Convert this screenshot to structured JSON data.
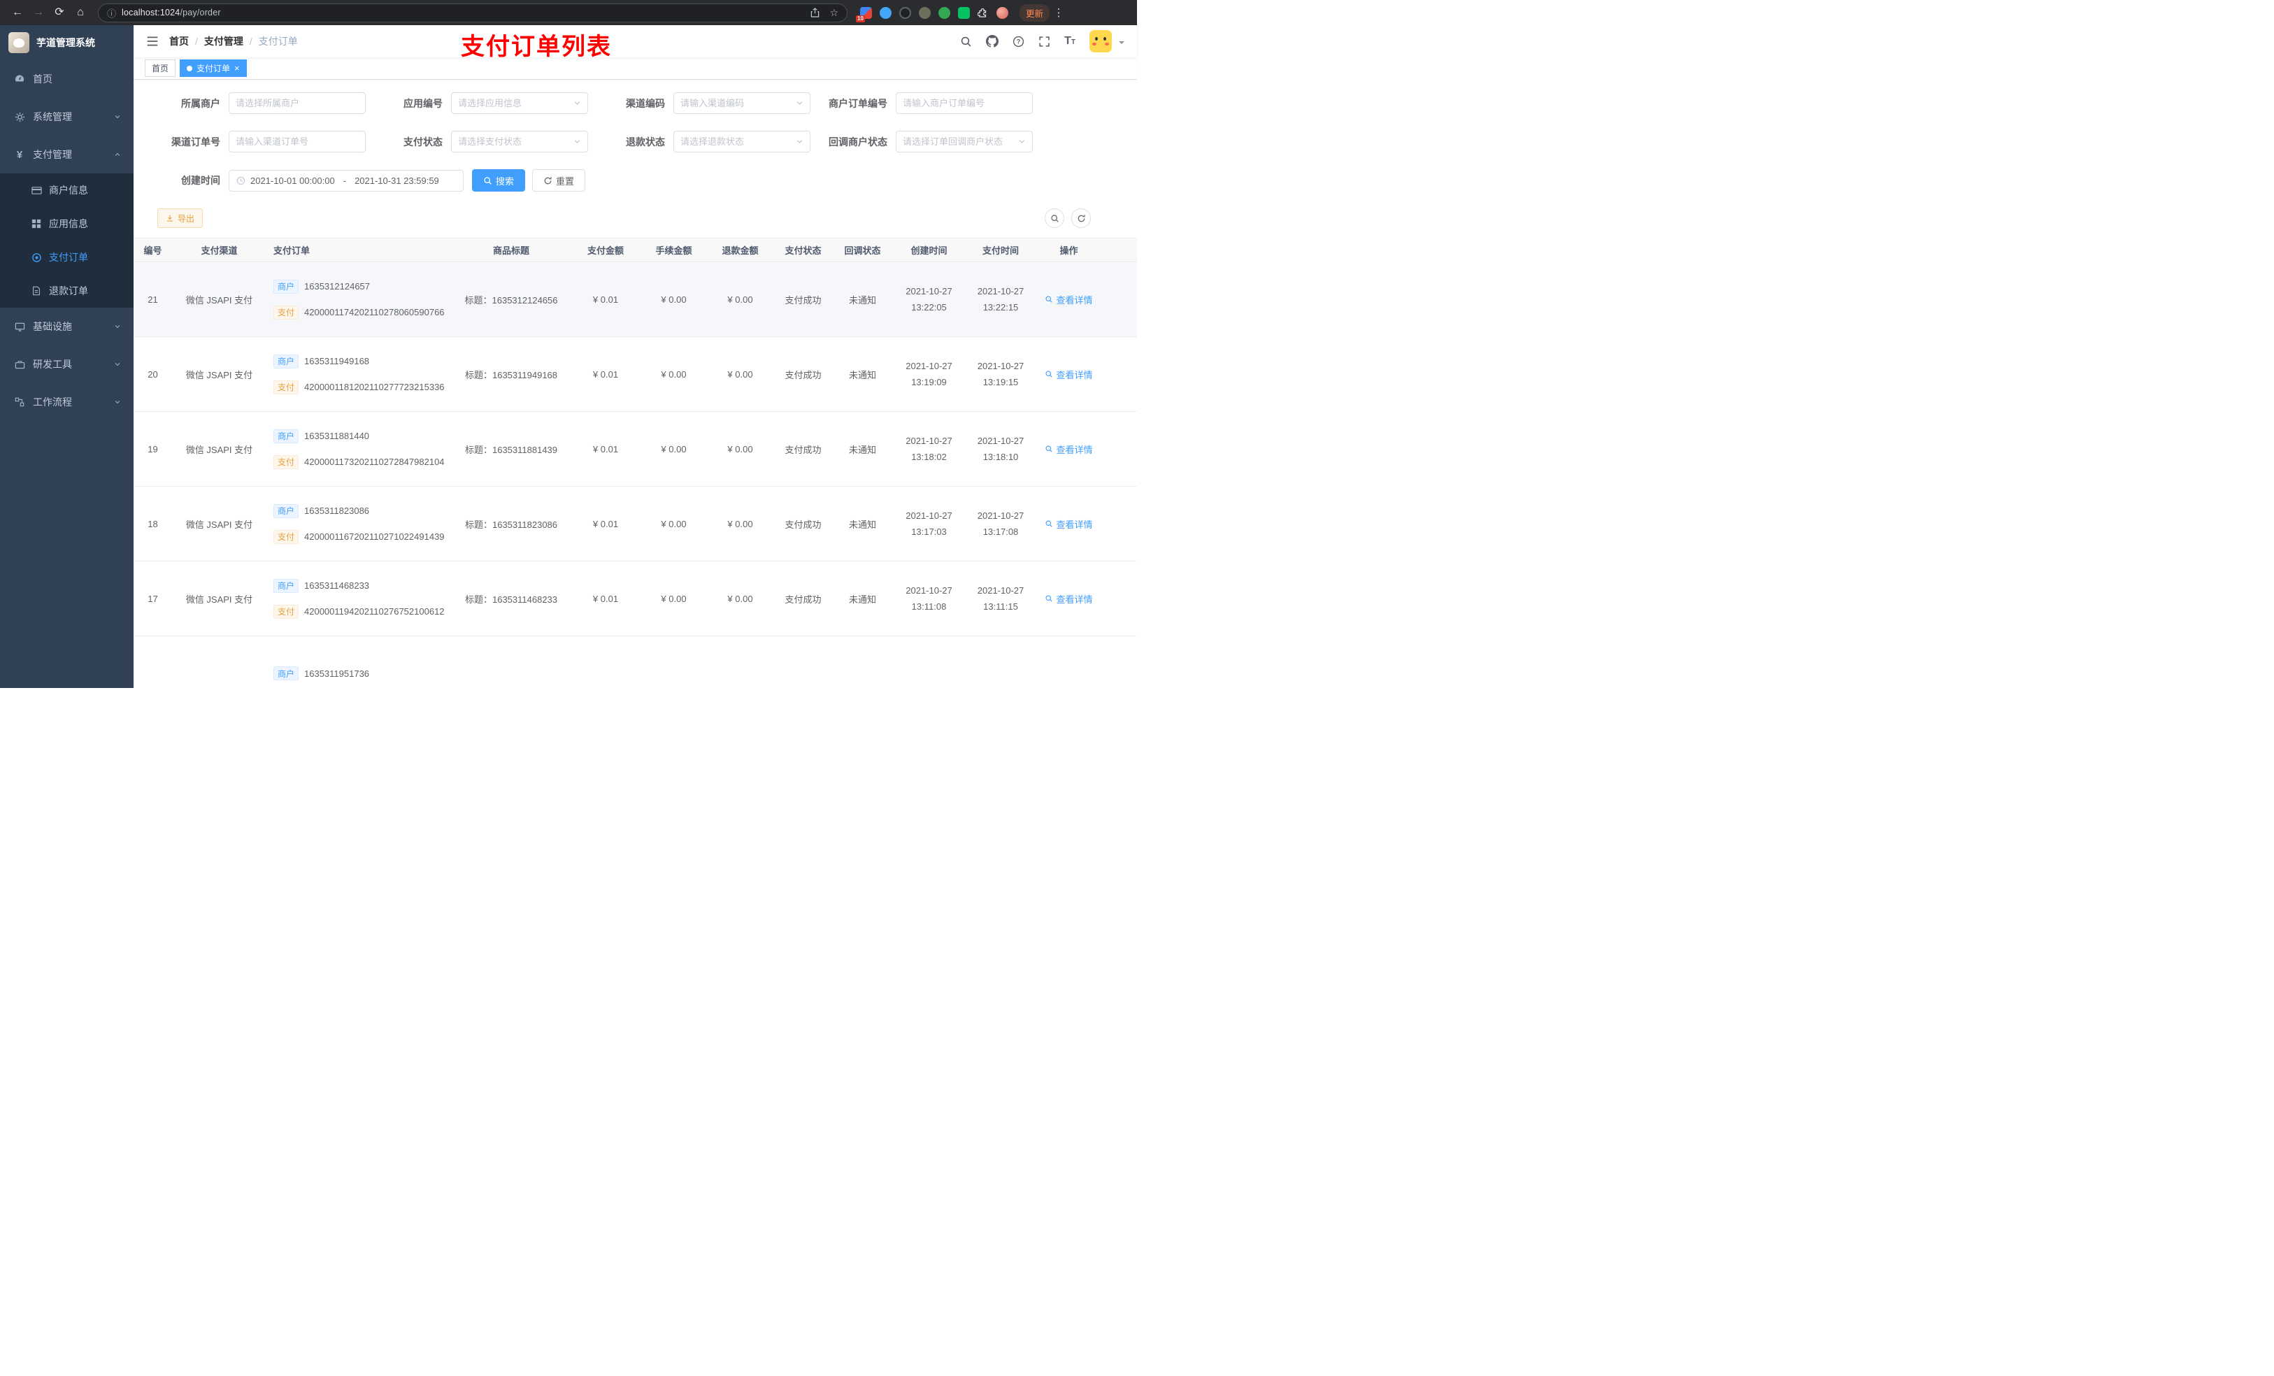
{
  "colors": {
    "accent": "#409eff",
    "warning": "#e6a23c",
    "annotation_red": "#fe0000",
    "sidebar_bg": "#304156",
    "submenu_bg": "#1f2d3d",
    "active_tab_bg": "#409eff"
  },
  "icons": {
    "back": "←",
    "forward": "→",
    "reload": "⟳",
    "home": "⌂",
    "info": "ⓘ",
    "star": "☆",
    "kebab": "⋮",
    "close": "×",
    "breadcrumb_sep": "/",
    "font_size_large": "T",
    "font_size_small": "T",
    "yen": "¥"
  },
  "browser": {
    "url_host": "localhost:1024",
    "url_path": "/pay/order",
    "extension_badge": "10",
    "update_label": "更新"
  },
  "sidebar": {
    "logo_title": "芋道管理系统",
    "menu": [
      {
        "label": "首页"
      },
      {
        "label": "系统管理"
      },
      {
        "label": "支付管理"
      },
      {
        "label": "基础设施"
      },
      {
        "label": "研发工具"
      },
      {
        "label": "工作流程"
      }
    ],
    "submenu": [
      {
        "label": "商户信息"
      },
      {
        "label": "应用信息"
      },
      {
        "label": "支付订单"
      },
      {
        "label": "退款订单"
      }
    ]
  },
  "navbar": {
    "breadcrumb": [
      "首页",
      "支付管理",
      "支付订单"
    ],
    "annotation": "支付订单列表"
  },
  "tabs": {
    "home": "首页",
    "current": "支付订单"
  },
  "filters": {
    "fields": [
      {
        "label": "所属商户",
        "placeholder": "请选择所属商户"
      },
      {
        "label": "应用编号",
        "placeholder": "请选择应用信息"
      },
      {
        "label": "渠道编码",
        "placeholder": "请输入渠道编码"
      },
      {
        "label": "商户订单编号",
        "placeholder": "请输入商户订单编号"
      },
      {
        "label": "渠道订单号",
        "placeholder": "请输入渠道订单号"
      },
      {
        "label": "支付状态",
        "placeholder": "请选择支付状态"
      },
      {
        "label": "退款状态",
        "placeholder": "请选择退款状态"
      },
      {
        "label": "回调商户状态",
        "placeholder": "请选择订单回调商户状态"
      }
    ],
    "date": {
      "label": "创建时间",
      "start": "2021-10-01 00:00:00",
      "separator": "-",
      "end": "2021-10-31 23:59:59"
    },
    "search_label": "搜索",
    "reset_label": "重置"
  },
  "toolbar": {
    "export_label": "导出"
  },
  "table": {
    "headers": [
      "编号",
      "支付渠道",
      "支付订单",
      "商品标题",
      "支付金额",
      "手续金额",
      "退款金额",
      "支付状态",
      "回调状态",
      "创建时间",
      "支付时间",
      "操作"
    ],
    "tag_merchant": "商户",
    "tag_pay": "支付",
    "action_label": "查看详情",
    "rows": [
      {
        "id": "21",
        "channel": "微信 JSAPI 支付",
        "merchant_no": "1635312124657",
        "pay_no": "4200001174202110278060590766",
        "title": "标题：1635312124656",
        "pay_amount": "¥ 0.01",
        "fee_amount": "¥ 0.00",
        "refund_amount": "¥ 0.00",
        "pay_status": "支付成功",
        "notify_status": "未通知",
        "create_time": "2021-10-27 13:22:05",
        "pay_time": "2021-10-27 13:22:15"
      },
      {
        "id": "20",
        "channel": "微信 JSAPI 支付",
        "merchant_no": "1635311949168",
        "pay_no": "4200001181202110277723215336",
        "title": "标题：1635311949168",
        "pay_amount": "¥ 0.01",
        "fee_amount": "¥ 0.00",
        "refund_amount": "¥ 0.00",
        "pay_status": "支付成功",
        "notify_status": "未通知",
        "create_time": "2021-10-27 13:19:09",
        "pay_time": "2021-10-27 13:19:15"
      },
      {
        "id": "19",
        "channel": "微信 JSAPI 支付",
        "merchant_no": "1635311881440",
        "pay_no": "4200001173202110272847982104",
        "title": "标题：1635311881439",
        "pay_amount": "¥ 0.01",
        "fee_amount": "¥ 0.00",
        "refund_amount": "¥ 0.00",
        "pay_status": "支付成功",
        "notify_status": "未通知",
        "create_time": "2021-10-27 13:18:02",
        "pay_time": "2021-10-27 13:18:10"
      },
      {
        "id": "18",
        "channel": "微信 JSAPI 支付",
        "merchant_no": "1635311823086",
        "pay_no": "4200001167202110271022491439",
        "title": "标题：1635311823086",
        "pay_amount": "¥ 0.01",
        "fee_amount": "¥ 0.00",
        "refund_amount": "¥ 0.00",
        "pay_status": "支付成功",
        "notify_status": "未通知",
        "create_time": "2021-10-27 13:17:03",
        "pay_time": "2021-10-27 13:17:08"
      },
      {
        "id": "17",
        "channel": "微信 JSAPI 支付",
        "merchant_no": "1635311468233",
        "pay_no": "4200001194202110276752100612",
        "title": "标题：1635311468233",
        "pay_amount": "¥ 0.01",
        "fee_amount": "¥ 0.00",
        "refund_amount": "¥ 0.00",
        "pay_status": "支付成功",
        "notify_status": "未通知",
        "create_time": "2021-10-27 13:11:08",
        "pay_time": "2021-10-27 13:11:15"
      },
      {
        "merchant_no": "1635311951736"
      }
    ]
  }
}
